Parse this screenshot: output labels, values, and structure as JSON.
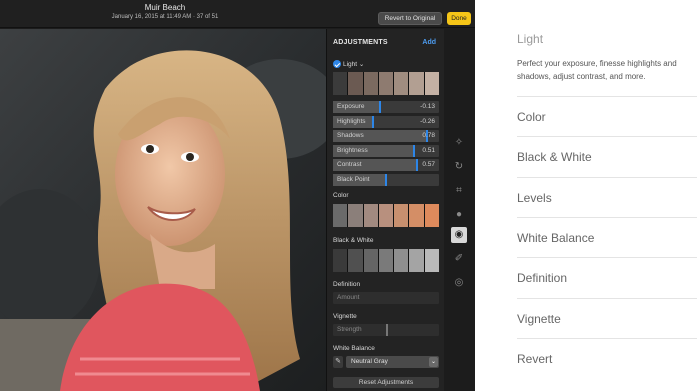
{
  "titlebar": {
    "title": "Muir Beach",
    "subtitle": "January 16, 2015 at 11:49 AM  ·  37 of 51",
    "revert_label": "Revert to Original",
    "done_label": "Done"
  },
  "panel": {
    "title": "ADJUSTMENTS",
    "add_label": "Add",
    "light": {
      "label": "Light ⌄",
      "sliders": [
        {
          "label": "Exposure",
          "value": "-0.13",
          "level": 0.44
        },
        {
          "label": "Highlights",
          "value": "-0.26",
          "level": 0.38
        },
        {
          "label": "Shadows",
          "value": "0.78",
          "level": 0.89
        },
        {
          "label": "Brightness",
          "value": "0.51",
          "level": 0.76
        },
        {
          "label": "Contrast",
          "value": "0.57",
          "level": 0.79
        },
        {
          "label": "Black Point",
          "value": "",
          "level": 0.5
        }
      ]
    },
    "color_label": "Color",
    "bw_label": "Black & White",
    "definition": {
      "label": "Definition",
      "slider_label": "Amount"
    },
    "vignette": {
      "label": "Vignette",
      "slider_label": "Strength",
      "level": 0.5
    },
    "white_balance": {
      "label": "White Balance",
      "selected": "Neutral Gray"
    },
    "reset_label": "Reset Adjustments"
  },
  "side": {
    "heading": "Light",
    "description": "Perfect your exposure, finesse highlights and shadows, adjust contrast, and more.",
    "items": [
      "Color",
      "Black & White",
      "Levels",
      "White Balance",
      "Definition",
      "Vignette",
      "Revert"
    ]
  },
  "colors": {
    "accent": "#2d86e8",
    "done": "#f5c518",
    "panel": "#232323"
  },
  "icons": [
    "magic-wand-icon",
    "rotate-icon",
    "crop-icon",
    "filters-icon",
    "adjust-icon",
    "retouch-icon",
    "red-eye-icon",
    "eyedropper-icon",
    "chevron-down-icon",
    "checkmark-icon"
  ]
}
